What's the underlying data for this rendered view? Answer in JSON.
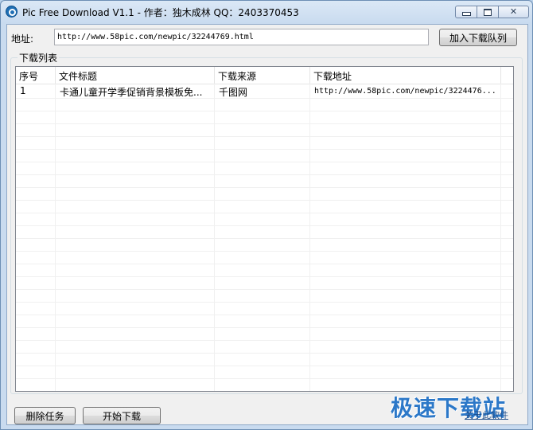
{
  "window": {
    "title": "Pic Free Download V1.1 - 作者：独木成林 QQ：2403370453",
    "minimize_icon": "minimize-icon",
    "maximize_icon": "maximize-icon",
    "close_icon": "close-icon",
    "close_glyph": "✕"
  },
  "address": {
    "label": "地址:",
    "value": "http://www.58pic.com/newpic/32244769.html",
    "add_button": "加入下载队列"
  },
  "download_list": {
    "group_title": "下载列表",
    "columns": [
      "序号",
      "文件标题",
      "下载来源",
      "下载地址"
    ],
    "rows": [
      [
        "1",
        "卡通儿童开学季促销背景模板免...",
        "千图网",
        "http://www.58pic.com/newpic/3224476..."
      ]
    ]
  },
  "footer": {
    "delete_button": "删除任务",
    "start_button": "开始下载"
  },
  "watermark": {
    "text": "极速下载站",
    "small_text": "关于此软件"
  },
  "colors": {
    "accent": "#2c78c8",
    "title_bar": "#c9dbef"
  }
}
